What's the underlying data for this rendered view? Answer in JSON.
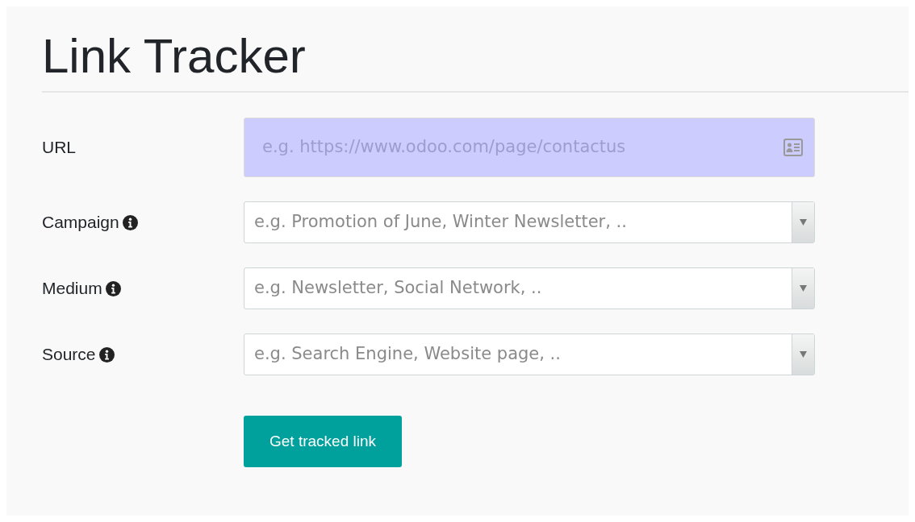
{
  "title": "Link Tracker",
  "fields": [
    {
      "label": "URL",
      "kind": "text",
      "info": false,
      "highlighted": true,
      "placeholder": "e.g. https://www.odoo.com/page/contactus"
    },
    {
      "label": "Campaign",
      "kind": "select",
      "info": true,
      "highlighted": false,
      "placeholder": "e.g. Promotion of June, Winter Newsletter, .."
    },
    {
      "label": "Medium",
      "kind": "select",
      "info": true,
      "highlighted": false,
      "placeholder": "e.g. Newsletter, Social Network, .."
    },
    {
      "label": "Source",
      "kind": "select",
      "info": true,
      "highlighted": false,
      "placeholder": "e.g. Search Engine, Website page, .."
    }
  ],
  "button": "Get tracked link"
}
